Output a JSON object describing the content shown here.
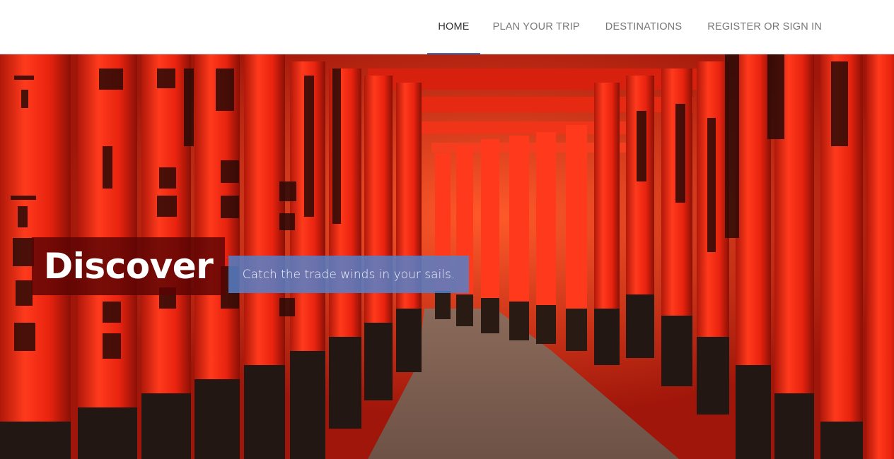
{
  "nav": {
    "items": [
      {
        "label": "HOME",
        "active": true
      },
      {
        "label": "PLAN YOUR TRIP",
        "active": false
      },
      {
        "label": "DESTINATIONS",
        "active": false
      },
      {
        "label": "REGISTER OR SIGN IN",
        "active": false
      }
    ]
  },
  "hero": {
    "title": "Discover",
    "tagline": "Catch the trade winds in your sails."
  },
  "colors": {
    "accent": "#3d6fb6",
    "torii_red": "#e8230f",
    "title_bg": "#5a0404",
    "tagline_bg": "#5680c8"
  }
}
